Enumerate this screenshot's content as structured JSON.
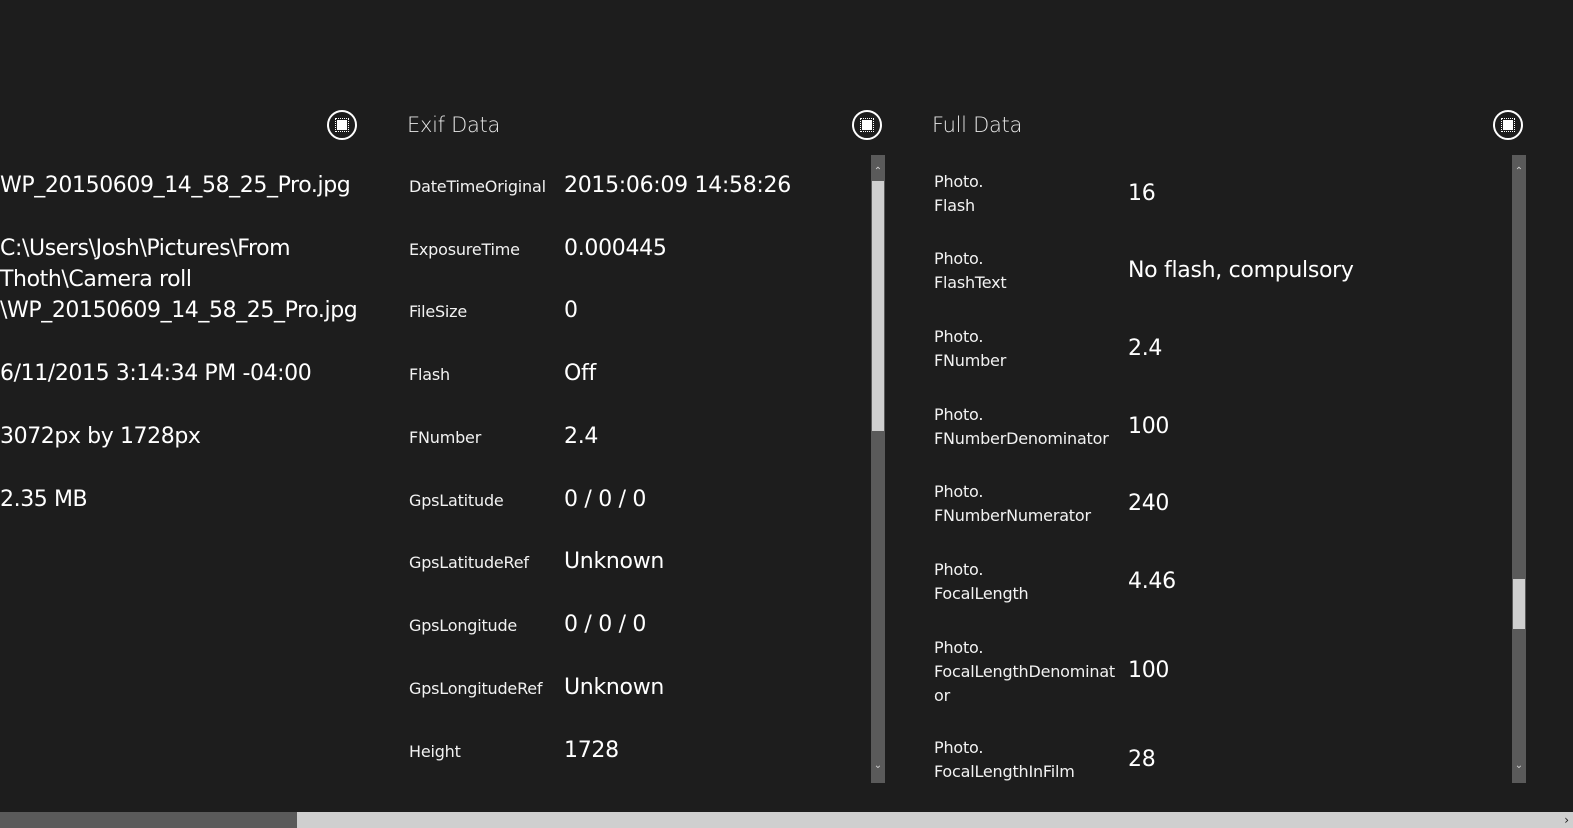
{
  "left_panel": {
    "items": [
      "WP_20150609_14_58_25_Pro.jpg",
      "C:\\Users\\Josh\\Pictures\\From\nThoth\\Camera roll\n\\WP_20150609_14_58_25_Pro.jpg",
      "6/11/2015 3:14:34 PM -04:00",
      "3072px by 1728px",
      "2.35 MB"
    ]
  },
  "exif_panel": {
    "title": "Exif Data",
    "rows": [
      {
        "key": "DateTimeOriginal",
        "value": "2015:06:09 14:58:26"
      },
      {
        "key": "ExposureTime",
        "value": "0.000445"
      },
      {
        "key": "FileSize",
        "value": "0"
      },
      {
        "key": "Flash",
        "value": "Off"
      },
      {
        "key": "FNumber",
        "value": "2.4"
      },
      {
        "key": "GpsLatitude",
        "value": "0 / 0 / 0"
      },
      {
        "key": "GpsLatitudeRef",
        "value": "Unknown"
      },
      {
        "key": "GpsLongitude",
        "value": "0 / 0 / 0"
      },
      {
        "key": "GpsLongitudeRef",
        "value": "Unknown"
      },
      {
        "key": "Height",
        "value": "1728"
      }
    ]
  },
  "full_panel": {
    "title": "Full Data",
    "rows": [
      {
        "key": "Photo.\nFlash",
        "value": "16"
      },
      {
        "key": "Photo.\nFlashText",
        "value": "No flash, compulsory"
      },
      {
        "key": "Photo.\nFNumber",
        "value": "2.4"
      },
      {
        "key": "Photo.\nFNumberDenominator",
        "value": "100"
      },
      {
        "key": "Photo.\nFNumberNumerator",
        "value": "240"
      },
      {
        "key": "Photo.\nFocalLength",
        "value": "4.46"
      },
      {
        "key": "Photo.\nFocalLengthDenominat\nor",
        "value": "100"
      },
      {
        "key": "Photo.\nFocalLengthInFilm",
        "value": "28"
      }
    ]
  },
  "icons": {
    "section_toggle": "grid-select-icon",
    "scroll_up": "chevron-up-icon",
    "scroll_down": "chevron-down-icon",
    "scroll_right": "chevron-right-icon"
  },
  "colors": {
    "background": "#1d1d1d",
    "text": "#ffffff",
    "scroll_track": "#5a5a5a",
    "scroll_thumb": "#cfcfcf"
  }
}
